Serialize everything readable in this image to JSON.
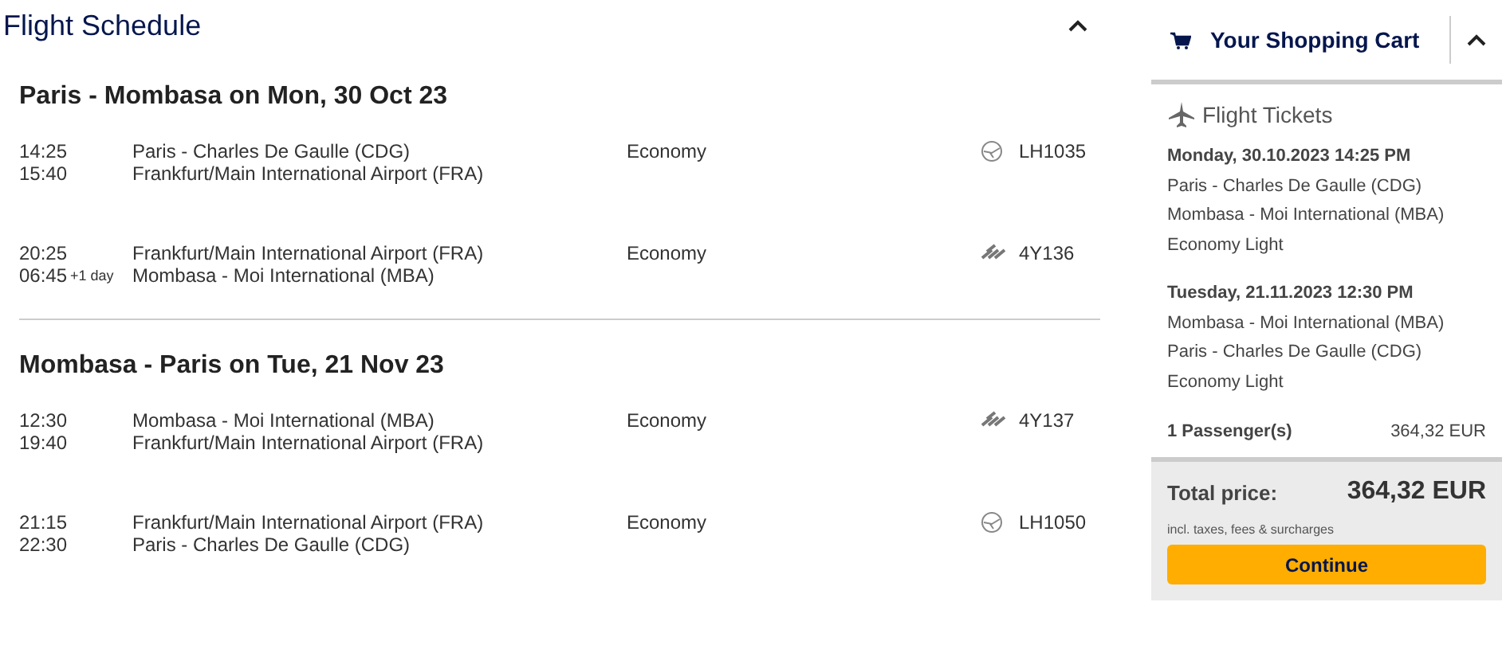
{
  "schedule": {
    "title": "Flight Schedule",
    "expanded": true,
    "journeys": [
      {
        "heading": "Paris - Mombasa on Mon, 30 Oct 23",
        "segments": [
          {
            "dep_time": "14:25",
            "arr_time": "15:40",
            "from": "Paris - Charles De Gaulle (CDG)",
            "to": "Frankfurt/Main International Airport (FRA)",
            "cabin": "Economy",
            "kind": "crane",
            "flight": "LH1035"
          },
          {
            "dep_time": "20:25",
            "arr_time": "06:45",
            "arr_offset": "+1 day",
            "from": "Frankfurt/Main International Airport (FRA)",
            "to": "Mombasa - Moi International (MBA)",
            "cabin": "Economy",
            "kind": "stripes",
            "flight": "4Y136"
          }
        ]
      },
      {
        "heading": "Mombasa - Paris on Tue, 21 Nov 23",
        "segments": [
          {
            "dep_time": "12:30",
            "arr_time": "19:40",
            "from": "Mombasa - Moi International (MBA)",
            "to": "Frankfurt/Main International Airport (FRA)",
            "cabin": "Economy",
            "kind": "stripes",
            "flight": "4Y137"
          },
          {
            "dep_time": "21:15",
            "arr_time": "22:30",
            "from": "Frankfurt/Main International Airport (FRA)",
            "to": "Paris - Charles De Gaulle (CDG)",
            "cabin": "Economy",
            "kind": "crane",
            "flight": "LH1050"
          }
        ]
      }
    ]
  },
  "cart": {
    "title": "Your Shopping Cart",
    "expanded": true,
    "section": "Flight Tickets",
    "tickets": [
      {
        "date": "Monday, 30.10.2023 14:25 PM",
        "from": "Paris - Charles De Gaulle (CDG)",
        "to": "Mombasa - Moi International (MBA)",
        "fare": "Economy Light"
      },
      {
        "date": "Tuesday, 21.11.2023 12:30 PM",
        "from": "Mombasa - Moi International (MBA)",
        "to": "Paris - Charles De Gaulle (CDG)",
        "fare": "Economy Light"
      }
    ],
    "passengers": "1 Passenger(s)",
    "passengers_price": "364,32 EUR",
    "total_label": "Total price:",
    "total": "364,32 EUR",
    "total_note": "incl. taxes, fees & surcharges",
    "continue": "Continue"
  }
}
